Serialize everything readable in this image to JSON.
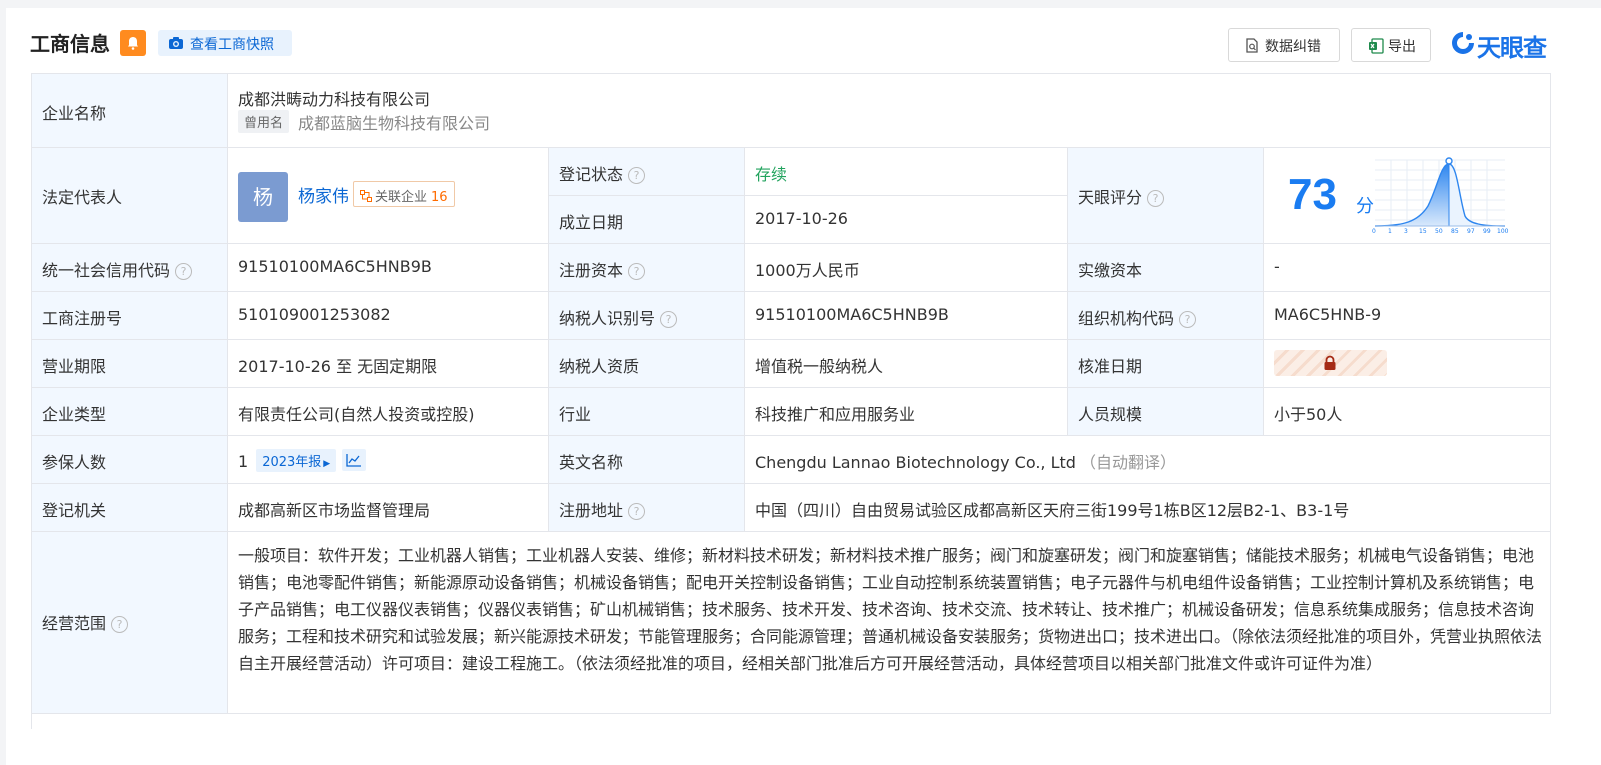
{
  "header": {
    "title": "工商信息",
    "snapshot_label": "查看工商快照",
    "correct_label": "数据纠错",
    "export_label": "导出",
    "brand": "天眼查"
  },
  "company": {
    "name_label": "企业名称",
    "name": "成都洪畴动力科技有限公司",
    "former_tag": "曾用名",
    "former_name": "成都蓝脑生物科技有限公司"
  },
  "rep": {
    "label": "法定代表人",
    "avatar": "杨",
    "name": "杨家伟",
    "related_label": "关联企业",
    "related_count": "16"
  },
  "reg_status": {
    "label": "登记状态",
    "value": "存续"
  },
  "found_date": {
    "label": "成立日期",
    "value": "2017-10-26"
  },
  "score": {
    "label": "天眼评分",
    "value": "73",
    "unit": "分",
    "axis_ticks": [
      "0",
      "1",
      "3",
      "15",
      "50",
      "85",
      "97",
      "99",
      "100"
    ]
  },
  "credit_code": {
    "label": "统一社会信用代码",
    "value": "91510100MA6C5HNB9B"
  },
  "reg_capital": {
    "label": "注册资本",
    "value": "1000万人民币"
  },
  "paid_capital": {
    "label": "实缴资本",
    "value": "-"
  },
  "reg_no": {
    "label": "工商注册号",
    "value": "510109001253082"
  },
  "taxpayer_id": {
    "label": "纳税人识别号",
    "value": "91510100MA6C5HNB9B"
  },
  "org_code": {
    "label": "组织机构代码",
    "value": "MA6C5HNB-9"
  },
  "term": {
    "label": "营业期限",
    "value": "2017-10-26 至 无固定期限"
  },
  "taxpayer_type": {
    "label": "纳税人资质",
    "value": "增值税一般纳税人"
  },
  "approve_date": {
    "label": "核准日期"
  },
  "company_type": {
    "label": "企业类型",
    "value": "有限责任公司(自然人投资或控股)"
  },
  "industry": {
    "label": "行业",
    "value": "科技推广和应用服务业"
  },
  "staff_size": {
    "label": "人员规模",
    "value": "小于50人"
  },
  "insured": {
    "label": "参保人数",
    "value": "1",
    "year_tag": "2023年报"
  },
  "english_name": {
    "label": "英文名称",
    "value": "Chengdu Lannao Biotechnology Co., Ltd",
    "auto_tag": "（自动翻译）"
  },
  "reg_authority": {
    "label": "登记机关",
    "value": "成都高新区市场监督管理局"
  },
  "reg_address": {
    "label": "注册地址",
    "value": "中国（四川）自由贸易试验区成都高新区天府三街199号1栋B区12层B2-1、B3-1号"
  },
  "scope": {
    "label": "经营范围",
    "value": "一般项目：软件开发；工业机器人销售；工业机器人安装、维修；新材料技术研发；新材料技术推广服务；阀门和旋塞研发；阀门和旋塞销售；储能技术服务；机械电气设备销售；电池销售；电池零配件销售；新能源原动设备销售；机械设备销售；配电开关控制设备销售；工业自动控制系统装置销售；电子元器件与机电组件设备销售；工业控制计算机及系统销售；电子产品销售；电工仪器仪表销售；仪器仪表销售；矿山机械销售；技术服务、技术开发、技术咨询、技术交流、技术转让、技术推广；机械设备研发；信息系统集成服务；信息技术咨询服务；工程和技术研究和试验发展；新兴能源技术研发；节能管理服务；合同能源管理；普通机械设备安装服务；货物进出口；技术进出口。（除依法须经批准的项目外，凭营业执照依法自主开展经营活动）许可项目：建设工程施工。（依法须经批准的项目，经相关部门批准后方可开展经营活动，具体经营项目以相关部门批准文件或许可证件为准）"
  },
  "colors": {
    "label_bg": "#f2f8ff",
    "border": "#e4e6eb",
    "accent": "#0b67d4",
    "status_green": "#22a35e",
    "score_blue": "#1a7cf1",
    "bell_orange": "#ff8b1f"
  },
  "icons": [
    "bell-icon",
    "camera-icon",
    "doc-search-icon",
    "excel-icon",
    "brand-logo-icon",
    "question-icon",
    "relation-icon",
    "trend-icon",
    "lock-icon"
  ]
}
